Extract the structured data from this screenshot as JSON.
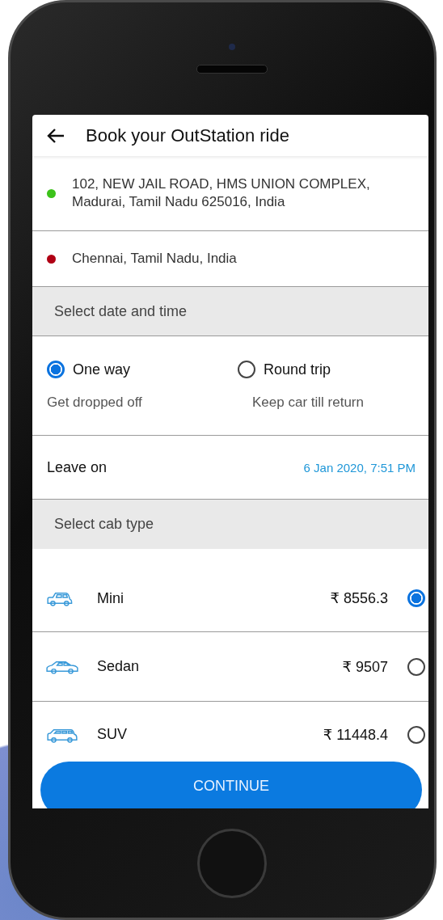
{
  "header": {
    "title": "Book your OutStation ride"
  },
  "locations": [
    {
      "address": "102, NEW JAIL ROAD, HMS UNION COMPLEX, Madurai, Tamil Nadu 625016, India",
      "color": "#3cc21a"
    },
    {
      "address": "Chennai, Tamil Nadu, India",
      "color": "#b00014"
    }
  ],
  "date_section": {
    "title": "Select date and time"
  },
  "trip_options": [
    {
      "label": "One way",
      "subtitle": "Get dropped off",
      "selected": true
    },
    {
      "label": "Round trip",
      "subtitle": "Keep car till return",
      "selected": false
    }
  ],
  "leave_on": {
    "label": "Leave on",
    "value": "6 Jan 2020, 7:51 PM"
  },
  "cab_section": {
    "title": "Select cab type"
  },
  "cab_types": [
    {
      "kind": "hatchback",
      "name": "Mini",
      "price": "₹ 8556.3",
      "selected": true
    },
    {
      "kind": "sedan",
      "name": "Sedan",
      "price": "₹ 9507",
      "selected": false
    },
    {
      "kind": "suv",
      "name": "SUV",
      "price": "₹ 11448.4",
      "selected": false
    }
  ],
  "continue_button": {
    "label": "CONTINUE"
  }
}
